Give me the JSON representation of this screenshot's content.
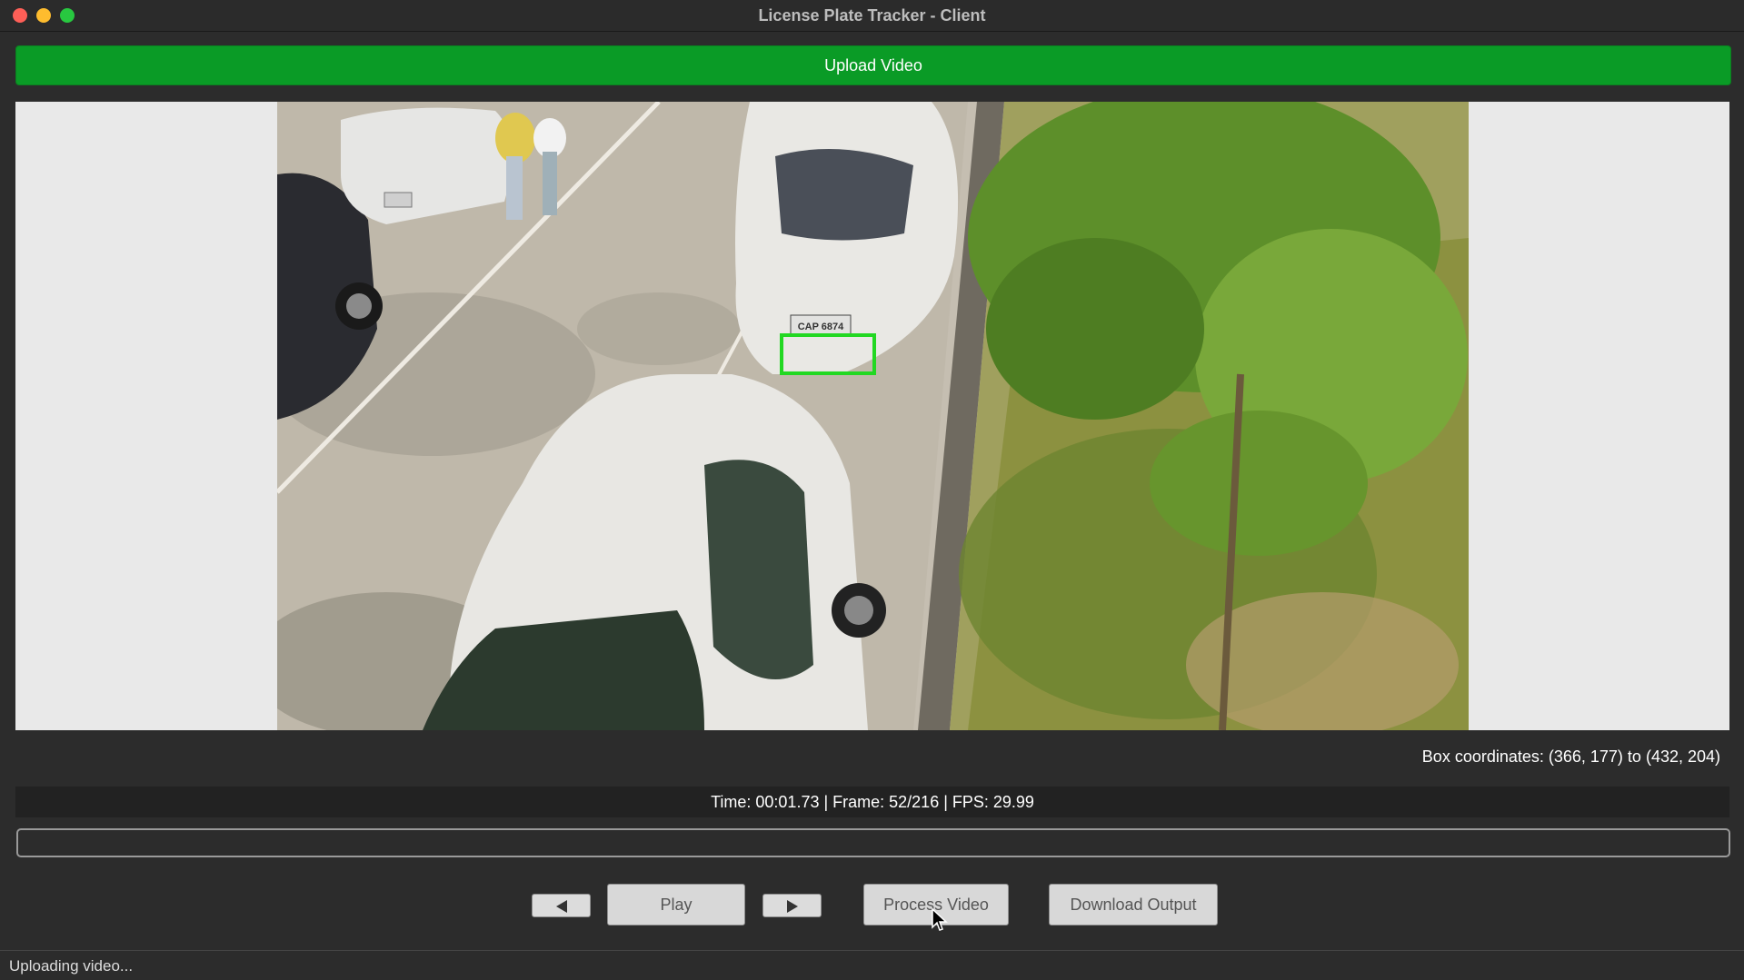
{
  "window": {
    "title": "License Plate Tracker - Client"
  },
  "toolbar": {
    "upload_label": "Upload Video"
  },
  "video": {
    "plate_text": "CAP 6874",
    "box_color": "#22d822"
  },
  "info": {
    "box_coordinates": "Box coordinates: (366, 177) to (432, 204)",
    "time_status": "Time: 00:01.73 | Frame: 52/216 | FPS: 29.99"
  },
  "progress": {
    "value_percent": 0
  },
  "controls": {
    "prev_icon": "prev-frame-icon",
    "play_label": "Play",
    "next_icon": "next-frame-icon",
    "process_label": "Process Video",
    "download_label": "Download Output"
  },
  "status": {
    "text": "Uploading video..."
  },
  "colors": {
    "upload_button": "#0a9b26",
    "window_bg": "#2c2c2c"
  }
}
